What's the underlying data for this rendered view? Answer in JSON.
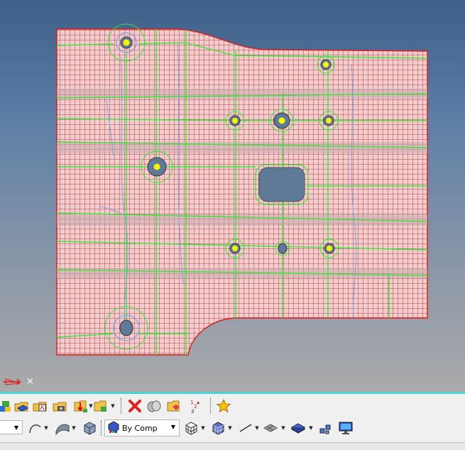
{
  "viewport": {
    "colors": {
      "mesh_fill": "#f2c9c9",
      "mesh_line": "#8c1f2a",
      "edge_green": "#39e639",
      "edge_blue": "#7f9fe0",
      "border_red": "#e01818",
      "washer_yellow": "#f5f500",
      "hole": "#5f7a99"
    },
    "axis_close_glyph": "×"
  },
  "toolbar": {
    "row1_icons": [
      "open-model-icon",
      "import-icon",
      "export-icon",
      "folder-camera-icon",
      "load-results-icon",
      "folder-cube-icon",
      "delete-icon",
      "mask-icon",
      "folder-red-icon",
      "renumber-icon",
      "favorite-star-icon"
    ],
    "row2_icons": [
      "curve-icon",
      "surface-icon",
      "solid-icon",
      "by-comp-icon",
      "wireframe-icon",
      "shaded-elements-icon",
      "line-icon",
      "plane-icon",
      "shaded-plane-icon",
      "entity-tree-icon",
      "monitor-icon"
    ],
    "color_mode": {
      "selected": "By Comp"
    }
  }
}
